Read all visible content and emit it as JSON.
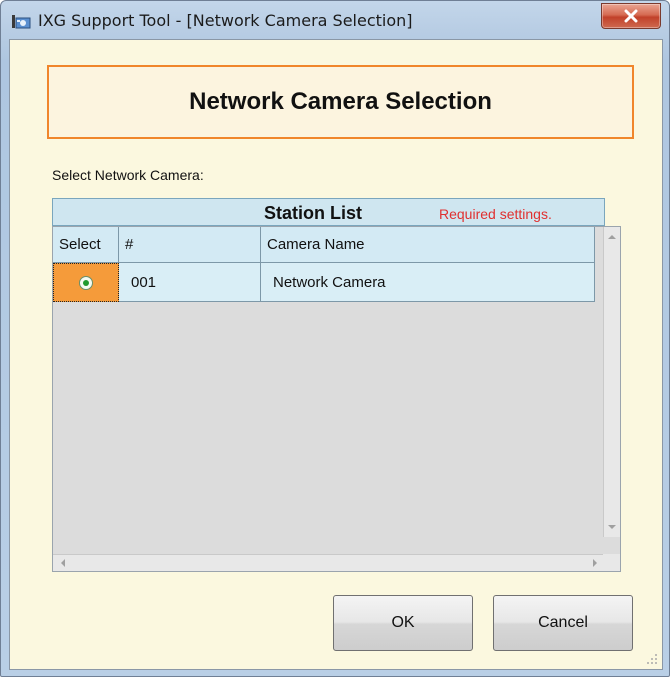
{
  "window": {
    "title": "IXG Support Tool - [Network Camera Selection]"
  },
  "header": {
    "title": "Network Camera Selection"
  },
  "form": {
    "select_label": "Select Network Camera:"
  },
  "station_list": {
    "title": "Station List",
    "required_note": "Required settings.",
    "columns": [
      "Select",
      "#",
      "Camera Name"
    ],
    "rows": [
      {
        "number": "001",
        "camera_name": "Network Camera",
        "selected": true
      }
    ]
  },
  "buttons": {
    "ok": "OK",
    "cancel": "Cancel"
  },
  "colors": {
    "accent_orange": "#f0862b",
    "required_red": "#e03030",
    "dialog_bg": "#fbf8df"
  },
  "icons": [
    "app-icon",
    "close-icon",
    "radio-selected-icon",
    "scroll-up-icon",
    "scroll-down-icon",
    "scroll-left-icon",
    "scroll-right-icon",
    "resize-grip-icon"
  ]
}
